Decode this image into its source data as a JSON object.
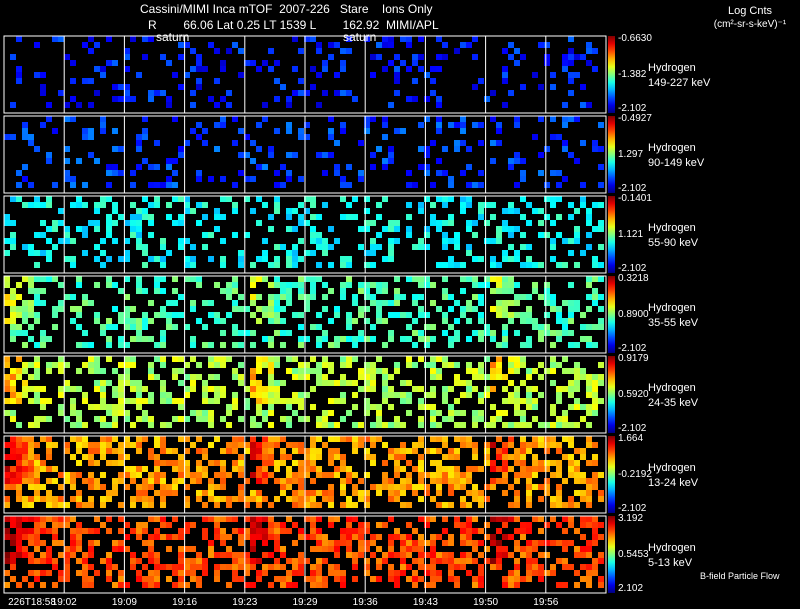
{
  "header": {
    "title": "Cassini/MIMI Inca mTOF  2007-226   Stare    Ions Only",
    "line2": "R        66.06 Lat 0.25 LT 1539 L        162.92  MIMI/APL",
    "saturn_labels": [
      "saturn",
      "saturn"
    ],
    "colorbar_title": "Log Cnts",
    "colorbar_units": "(cm²-sr-s-keV)⁻¹"
  },
  "chart_data": {
    "type": "heatmap",
    "x_ticks": [
      "226T18:58",
      "19:02",
      "19:09",
      "19:16",
      "19:23",
      "19:29",
      "19:36",
      "19:43",
      "19:50",
      "19:56"
    ],
    "panels": [
      {
        "species": "Hydrogen",
        "energy": "149-227 keV",
        "cb_max": "-0.6630",
        "cb_mid": "-1.382",
        "cb_min": "-2.102"
      },
      {
        "species": "Hydrogen",
        "energy": "90-149 keV",
        "cb_max": "-0.4927",
        "cb_mid": "1.297",
        "cb_min": "-2.102"
      },
      {
        "species": "Hydrogen",
        "energy": "55-90 keV",
        "cb_max": "-0.1401",
        "cb_mid": "1.121",
        "cb_min": "-2.102"
      },
      {
        "species": "Hydrogen",
        "energy": "35-55 keV",
        "cb_max": "0.3218",
        "cb_mid": "0.8900",
        "cb_min": "-2.102"
      },
      {
        "species": "Hydrogen",
        "energy": "24-35 keV",
        "cb_max": "0.9179",
        "cb_mid": "0.5920",
        "cb_min": "-2.102"
      },
      {
        "species": "Hydrogen",
        "energy": "13-24 keV",
        "cb_max": "1.664",
        "cb_mid": "-0.2192",
        "cb_min": "-2.102"
      },
      {
        "species": "Hydrogen",
        "energy": "5-13 keV",
        "cb_max": "3.192",
        "cb_mid": "0.5453",
        "cb_min": "2.102"
      }
    ]
  },
  "footer": {
    "bfield": "B-field Particle Flow"
  }
}
